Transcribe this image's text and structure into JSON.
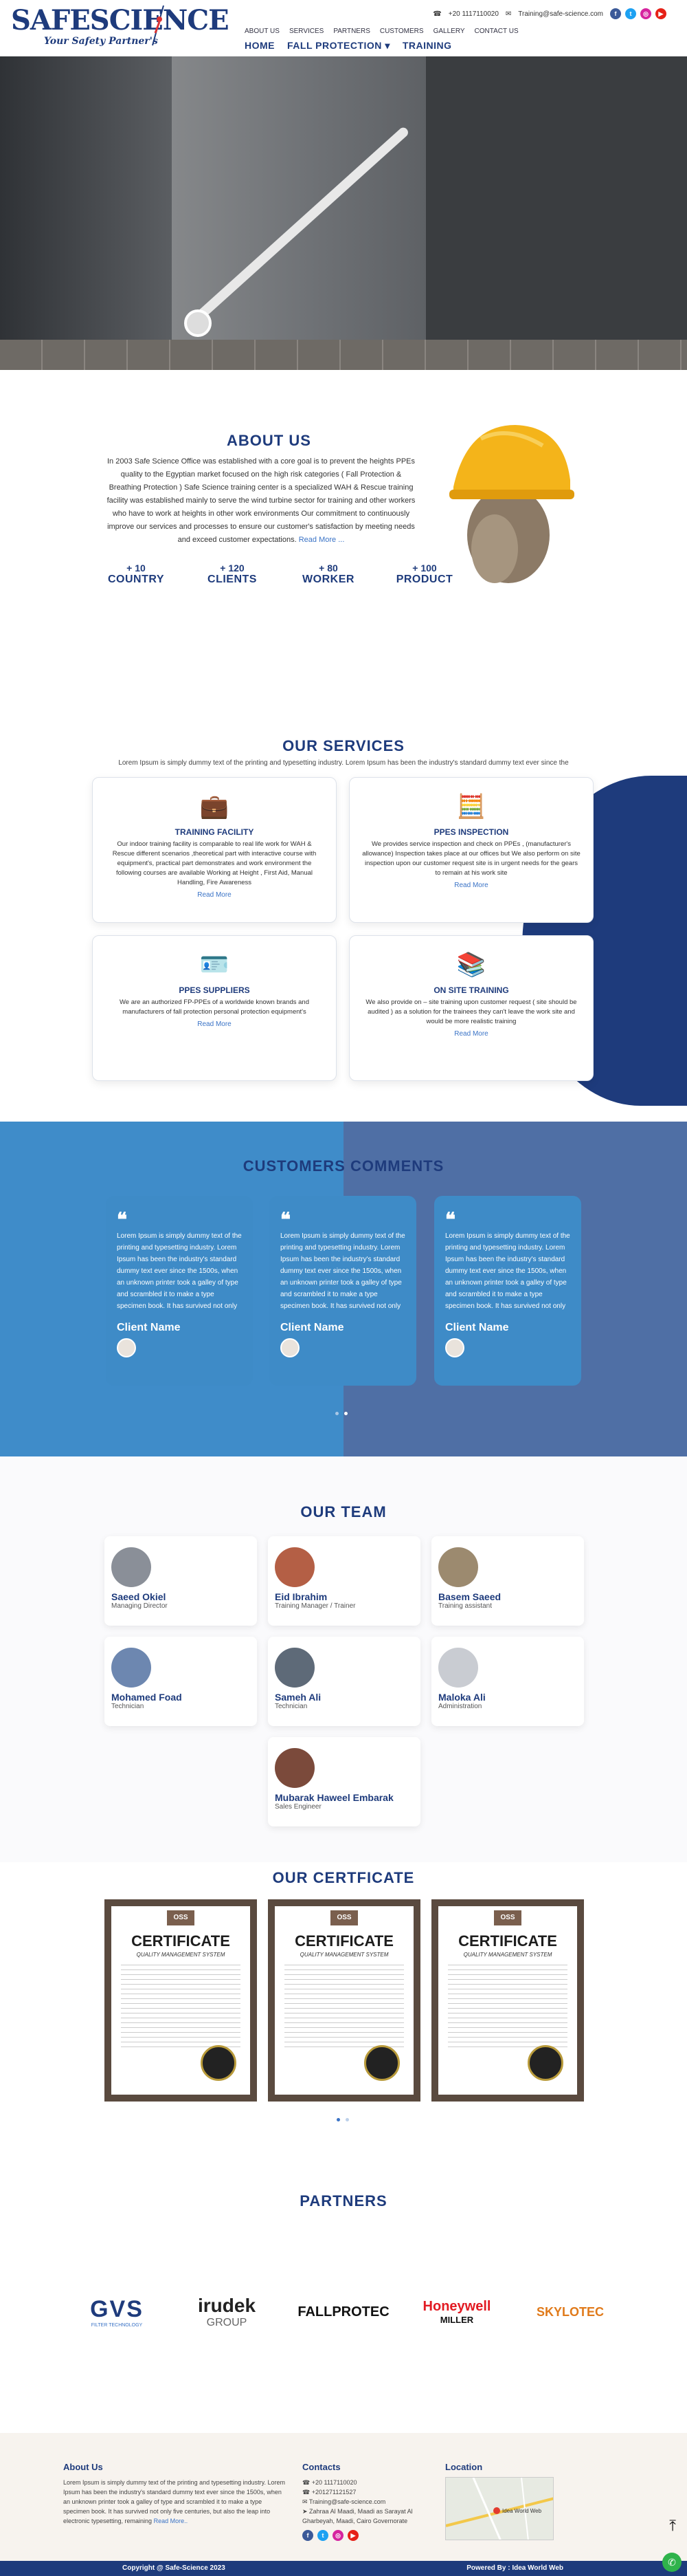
{
  "header": {
    "logo_main": "SAFESCIENCE",
    "logo_sub": "Your Safety Partner's",
    "topnav": [
      "ABOUT US",
      "SERVICES",
      "PARTNERS",
      "CUSTOMERS",
      "GALLERY",
      "CONTACT US"
    ],
    "phone": "+20 1117110020",
    "email": "Training@safe-science.com",
    "mainnav": [
      "HOME",
      "FALL PROTECTION",
      "TRAINING"
    ]
  },
  "about": {
    "title": "ABOUT US",
    "text": "In 2003 Safe Science Office was established with a core goal is to prevent the heights PPEs quality to the Egyptian market focused on the high risk categories ( Fall Protection & Breathing Protection ) Safe Science training center is a specialized WAH & Rescue training facility was established mainly to serve the wind turbine sector for training and other workers who have to work at heights in other work environments Our commitment to continuously improve our services and processes to ensure our customer's satisfaction by meeting needs and exceed customer expectations.",
    "more": "Read More ...",
    "stats": [
      {
        "num": "+ 10",
        "label": "COUNTRY"
      },
      {
        "num": "+ 120",
        "label": "CLIENTS"
      },
      {
        "num": "+ 80",
        "label": "WORKER"
      },
      {
        "num": "+ 100",
        "label": "PRODUCT"
      }
    ]
  },
  "services": {
    "title": "OUR SERVICES",
    "subtitle": "Lorem Ipsum is simply dummy text of the printing and typesetting industry. Lorem Ipsum has been the industry's standard dummy text ever since the",
    "items": [
      {
        "title": "TRAINING FACILITY",
        "text": "Our indoor training facility is comparable to real life work for WAH & Rescue different scenarios ,theoretical part with interactive course with equipment's, practical part demonstrates and work environment the following courses are available Working at Height , First Aid, Manual Handling, Fire Awareness",
        "more": "Read More",
        "icon": "briefcase-icon"
      },
      {
        "title": "PPES INSPECTION",
        "text": "We provides service inspection and check on PPEs , (manufacturer's allowance) Inspection takes place at our offices but We also perform on site inspection upon our customer request site is in urgent needs for the gears to remain at his work site",
        "more": "Read More",
        "icon": "calculator-icon"
      },
      {
        "title": "PPES SUPPLIERS",
        "text": "We are an authorized FP-PPEs of a worldwide known brands and manufacturers of fall protection personal protection equipment's",
        "more": "Read More",
        "icon": "id-card-icon"
      },
      {
        "title": "ON SITE TRAINING",
        "text": "We also provide on – site training upon customer request ( site should be audited ) as a solution for the trainees they can't leave the work site and would be more realistic training",
        "more": "Read More",
        "icon": "books-icon"
      }
    ]
  },
  "customers": {
    "title": "CUSTOMERS COMMENTS",
    "items": [
      {
        "text": "Lorem Ipsum is simply dummy text of the printing and typesetting industry. Lorem Ipsum has been the industry's standard dummy text ever since the 1500s, when an unknown printer took a galley of type and scrambled it to make a type specimen book. It has survived not only",
        "name": "Client Name"
      },
      {
        "text": "Lorem Ipsum is simply dummy text of the printing and typesetting industry. Lorem Ipsum has been the industry's standard dummy text ever since the 1500s, when an unknown printer took a galley of type and scrambled it to make a type specimen book. It has survived not only",
        "name": "Client Name"
      },
      {
        "text": "Lorem Ipsum is simply dummy text of the printing and typesetting industry. Lorem Ipsum has been the industry's standard dummy text ever since the 1500s, when an unknown printer took a galley of type and scrambled it to make a type specimen book. It has survived not only",
        "name": "Client Name"
      }
    ]
  },
  "team": {
    "title": "OUR TEAM",
    "members": [
      {
        "name": "Saeed Okiel",
        "role": "Managing Director"
      },
      {
        "name": "Eid Ibrahim",
        "role": "Training Manager / Trainer"
      },
      {
        "name": "Basem Saeed",
        "role": "Training assistant"
      },
      {
        "name": "Mohamed Foad",
        "role": "Technician"
      },
      {
        "name": "Sameh Ali",
        "role": "Technician"
      },
      {
        "name": "Maloka Ali",
        "role": "Administration"
      },
      {
        "name": "Mubarak Haweel Embarak",
        "role": "Sales Engineer"
      }
    ]
  },
  "certificate": {
    "title": "OUR CERTFICATE",
    "items": [
      {
        "brand": "OSS",
        "heading": "CERTIFICATE",
        "sub": "QUALITY MANAGEMENT SYSTEM"
      },
      {
        "brand": "OSS",
        "heading": "CERTIFICATE",
        "sub": "QUALITY MANAGEMENT SYSTEM"
      },
      {
        "brand": "OSS",
        "heading": "CERTIFICATE",
        "sub": "QUALITY MANAGEMENT SYSTEM"
      }
    ]
  },
  "partners": {
    "title": "PARTNERS",
    "logos": [
      {
        "name": "GVS",
        "sub": "FILTER TECHNOLOGY"
      },
      {
        "name": "irudek",
        "sub": "GROUP"
      },
      {
        "name": "FALLPROTEC",
        "sub": ""
      },
      {
        "name": "Honeywell",
        "sub": "MILLER"
      },
      {
        "name": "SKYLOTEC",
        "sub": ""
      }
    ]
  },
  "footer": {
    "about_title": "About Us",
    "about_text": "Lorem Ipsum is simply dummy text of the printing and typesetting industry. Lorem Ipsum has been the industry's standard dummy text ever since the 1500s, when an unknown printer took a galley of type and scrambled it to make a type specimen book. It has survived not only five centuries, but also the leap into electronic typesetting, remaining",
    "about_more": "Read More..",
    "contacts_title": "Contacts",
    "contact_phone1": "+20 1117110020",
    "contact_phone2": "+201271121527",
    "contact_email": "Training@safe-science.com",
    "contact_address": "Zahraa Al Maadi, Maadi as Sarayat Al Gharbeyah, Maadi, Cairo Governorate",
    "location_title": "Location",
    "map_label": "Idea World Web",
    "copyright": "Copyright @ Safe-Science 2023",
    "powered": "Powered By : Idea World Web"
  }
}
